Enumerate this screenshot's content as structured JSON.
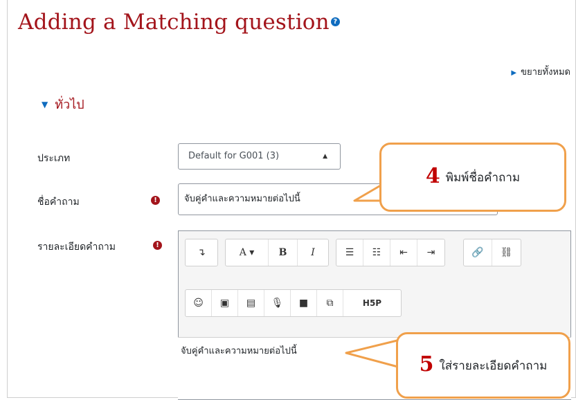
{
  "page": {
    "title": "Adding a Matching question",
    "expand_all": "ขยายทั้งหมด",
    "section": "ทั่วไป"
  },
  "form": {
    "category_label": "ประเภท",
    "category_value": "Default for G001 (3)",
    "name_label": "ชื่อคำถาม",
    "name_value": "จับคู่คำและความหมายต่อไปนี้",
    "text_label": "รายละเอียดคำถาม",
    "text_value": "จับคู่คำและความหมายต่อไปนี้",
    "required_glyph": "!"
  },
  "toolbar": {
    "row1": [
      [
        "show-more-icon",
        "↴"
      ],
      [
        "paragraph-style-icon",
        "A ▾"
      ],
      [
        "bold-icon",
        "B"
      ],
      [
        "italic-icon",
        "I"
      ],
      [
        "unordered-list-icon",
        "☰"
      ],
      [
        "ordered-list-icon",
        "☷"
      ],
      [
        "outdent-icon",
        "⇤"
      ],
      [
        "indent-icon",
        "⇥"
      ],
      [
        "link-icon",
        "🔗"
      ],
      [
        "unlink-icon",
        "⛓"
      ]
    ],
    "row2": [
      [
        "emoji-icon",
        "☺"
      ],
      [
        "image-icon",
        "▣"
      ],
      [
        "media-icon",
        "▤"
      ],
      [
        "record-audio-icon",
        "🎙"
      ],
      [
        "record-video-icon",
        "■"
      ],
      [
        "manage-files-icon",
        "⧉"
      ],
      [
        "h5p-icon",
        "H5P"
      ]
    ]
  },
  "callouts": [
    {
      "num": "4",
      "text": "พิมพ์ชื่อคำถาม"
    },
    {
      "num": "5",
      "text": "ใส่รายละเอียดคำถาม"
    }
  ],
  "colors": {
    "heading": "#a3141b",
    "accent": "#0f6cbf",
    "callout_border": "#f0a04b",
    "callout_num": "#c00000"
  }
}
